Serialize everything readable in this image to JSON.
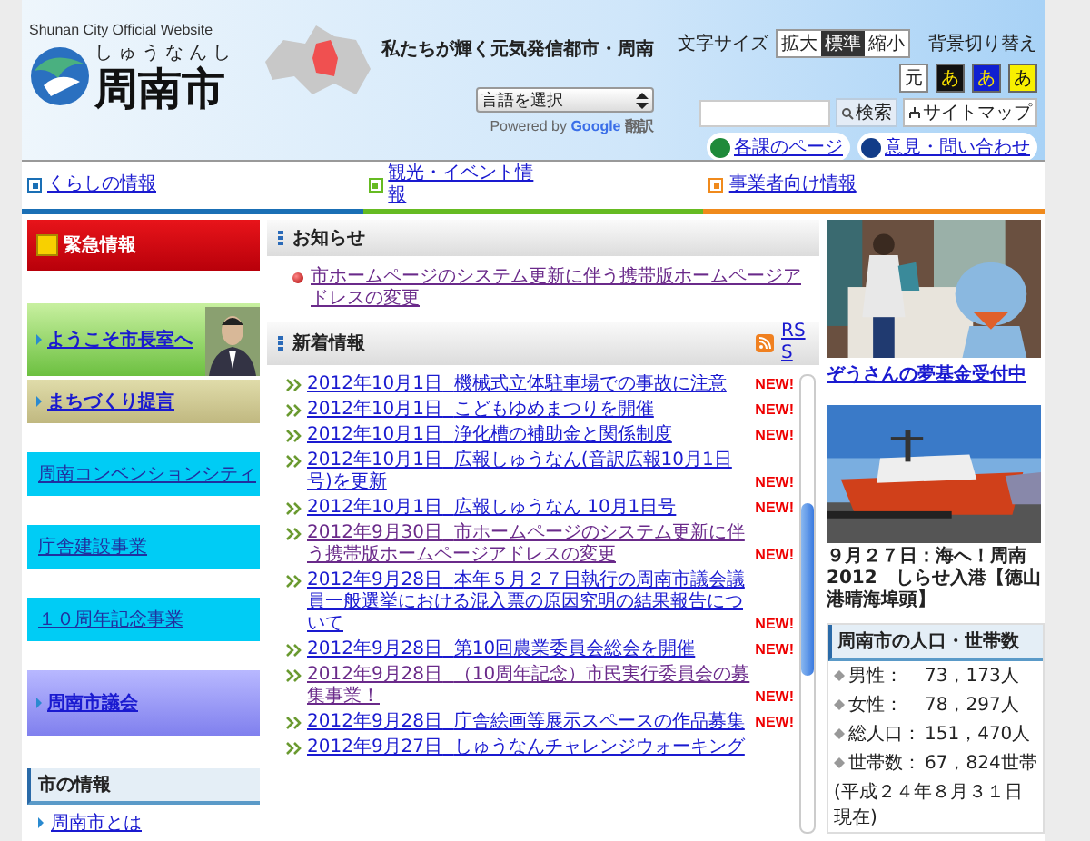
{
  "header": {
    "subtitle": "Shunan City Official Website",
    "reading": "しゅうなんし",
    "name": "周南市",
    "tagline": "私たちが輝く元気発信都市・周南",
    "text_size": {
      "label": "文字サイズ",
      "options": [
        {
          "label": "拡大",
          "selected": false
        },
        {
          "label": "標準",
          "selected": true
        },
        {
          "label": "縮小",
          "selected": false
        }
      ]
    },
    "background": {
      "label": "背景切り替え",
      "reset": "元",
      "options": [
        {
          "label": "あ",
          "color": "#111111"
        },
        {
          "label": "あ",
          "color": "#1020d0"
        },
        {
          "label": "あ",
          "color": "#f8f000"
        }
      ]
    },
    "search": {
      "button": "検索"
    },
    "sitemap": "サイトマップ",
    "language": {
      "value": "言語を選択",
      "powered": "Powered by",
      "brand": "Google",
      "translate": "翻訳"
    },
    "links": [
      {
        "label": "各課のページ",
        "color": "#1f8a3a"
      },
      {
        "label": "意見・問い合わせ",
        "color": "#123c88"
      }
    ]
  },
  "nav": [
    {
      "label": "くらしの情報",
      "color": "#1a6fb5"
    },
    {
      "label": "観光・イベント情報",
      "color": "#66bb22"
    },
    {
      "label": "事業者向け情報",
      "color": "#f08a1c"
    }
  ],
  "sidebar": {
    "items": [
      {
        "label": "緊急情報",
        "kind": "alert"
      },
      {
        "label": "ようこそ市長室へ",
        "kind": "mayor"
      },
      {
        "label": "まちづくり提言",
        "kind": "khaki"
      },
      {
        "label": "周南コンベンションシティ",
        "kind": "cyan"
      },
      {
        "label": "庁舎建設事業",
        "kind": "cyan"
      },
      {
        "label": "１０周年記念事業",
        "kind": "cyan"
      },
      {
        "label": "周南市議会",
        "kind": "purple"
      }
    ],
    "section": {
      "title": "市の情報",
      "links": [
        "周南市とは"
      ]
    }
  },
  "notices": {
    "title": "お知らせ",
    "items": [
      {
        "text": "市ホームページのシステム更新に伴う携帯版ホームページアドレスの変更",
        "visited": true
      }
    ]
  },
  "news": {
    "title": "新着情報",
    "rss": "RSS",
    "items": [
      {
        "date": "2012年10月1日",
        "text": "機械式立体駐車場での事故に注意",
        "badge": "NEW!",
        "visited": false
      },
      {
        "date": "2012年10月1日",
        "text": "こどもゆめまつりを開催",
        "badge": "NEW!",
        "visited": false
      },
      {
        "date": "2012年10月1日",
        "text": "浄化槽の補助金と関係制度",
        "badge": "NEW!",
        "visited": false
      },
      {
        "date": "2012年10月1日",
        "text": "広報しゅうなん(音訳広報10月1日号)を更新",
        "badge": "NEW!",
        "visited": false
      },
      {
        "date": "2012年10月1日",
        "text": "広報しゅうなん 10月1日号",
        "badge": "NEW!",
        "visited": false
      },
      {
        "date": "2012年9月30日",
        "text": "市ホームページのシステム更新に伴う携帯版ホームページアドレスの変更",
        "badge": "NEW!",
        "visited": true
      },
      {
        "date": "2012年9月28日",
        "text": "本年５月２７日執行の周南市議会議員一般選挙における混入票の原因究明の結果報告について",
        "badge": "NEW!",
        "visited": false
      },
      {
        "date": "2012年9月28日",
        "text": "第10回農業委員会総会を開催",
        "badge": "NEW!",
        "visited": false
      },
      {
        "date": "2012年9月28日",
        "text": "（10周年記念）市民実行委員会の募集事業！",
        "badge": "NEW!",
        "visited": true
      },
      {
        "date": "2012年9月28日",
        "text": "庁舎絵画等展示スペースの作品募集",
        "badge": "NEW!",
        "visited": false
      },
      {
        "date": "2012年9月27日",
        "text": "しゅうなんチャレンジウォーキング",
        "visited": false
      }
    ]
  },
  "features": [
    {
      "kind": "picture",
      "caption": "ぞうさんの夢基金受付中",
      "link": true
    },
    {
      "kind": "picture",
      "caption": "９月２７日：海へ！周南2012　しらせ入港【徳山港晴海埠頭】",
      "link": false
    }
  ],
  "population": {
    "title": "周南市の人口・世帯数",
    "rows": [
      {
        "label": "男性：",
        "value": "73，173人"
      },
      {
        "label": "女性：",
        "value": "78，297人"
      },
      {
        "label": "総人口：",
        "value": "151，470人"
      },
      {
        "label": "世帯数：",
        "value": "67，824世帯"
      }
    ],
    "note": "(平成２４年８月３１日現在)"
  }
}
